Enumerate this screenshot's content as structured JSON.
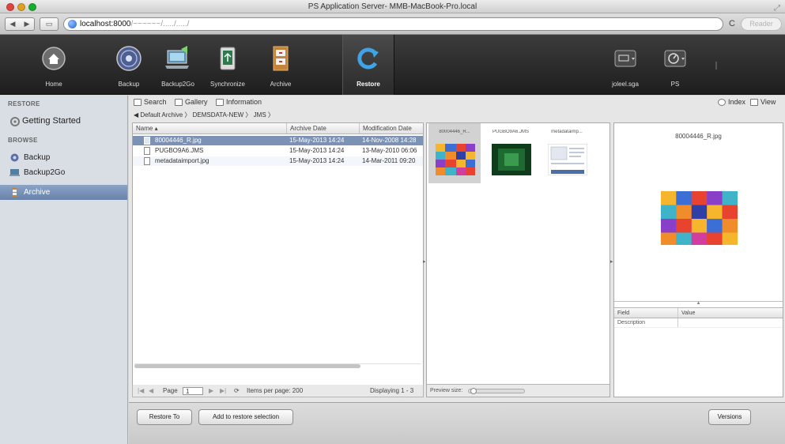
{
  "window": {
    "title": "PS Application Server- MMB-MacBook-Pro.local"
  },
  "browser": {
    "back": "◀",
    "forward": "▶",
    "address_host": "localhost:8000",
    "address_path": "/~~~~~~/...../...../",
    "reader_label": "Reader"
  },
  "toolbar": {
    "items": [
      {
        "label": "Home",
        "icon": "home-icon"
      },
      {
        "label": "Backup",
        "icon": "backup-icon"
      },
      {
        "label": "Backup2Go",
        "icon": "backup2go-icon"
      },
      {
        "label": "Synchronize",
        "icon": "synchronize-icon"
      },
      {
        "label": "Archive",
        "icon": "archive-icon"
      },
      {
        "label": "Restore",
        "icon": "restore-icon"
      }
    ],
    "active": "Restore",
    "user_label": "joleel.sga",
    "server_label": "PS"
  },
  "sidebar": {
    "restore_heading": "RESTORE",
    "browse_heading": "BROWSE",
    "items": [
      {
        "label": "Getting Started"
      },
      {
        "label": "Backup"
      },
      {
        "label": "Backup2Go"
      },
      {
        "label": "Archive"
      }
    ],
    "selected": "Archive"
  },
  "main": {
    "view_tabs": [
      {
        "label": "Search"
      },
      {
        "label": "Gallery"
      },
      {
        "label": "Information"
      }
    ],
    "right_tabs": [
      {
        "label": "Index"
      },
      {
        "label": "View"
      }
    ],
    "breadcrumb": "◀  Default Archive  〉 DEMSDATA-NEW  〉 JMS  〉",
    "list": {
      "columns": [
        "Name",
        "Archive Date",
        "Modification Date"
      ],
      "rows": [
        {
          "name": "80004446_R.jpg",
          "archive_date": "15-May-2013 14:24",
          "mod_date": "14-Nov-2008 14:28"
        },
        {
          "name": "PUGBO9A6.JMS",
          "archive_date": "15-May-2013 14:24",
          "mod_date": "13-May-2010 06:06"
        },
        {
          "name": "metadataimport.jpg",
          "archive_date": "15-May-2013 14:24",
          "mod_date": "14-Mar-2011 09:20"
        }
      ]
    },
    "pager": {
      "page_label": "Page",
      "page_value": "1",
      "items_per_page": "Items per page: 200",
      "displaying": "Displaying 1 - 3"
    },
    "thumbnails": [
      {
        "name": "80004446_R..."
      },
      {
        "name": "PUGBO9A6.JMS"
      },
      {
        "name": "metadataimp..."
      }
    ],
    "preview_size_label": "Preview size:",
    "preview": {
      "filename": "80004446_R.jpg",
      "field_header": "Field",
      "value_header": "Value",
      "fields": [
        {
          "field": "Description",
          "value": ""
        }
      ]
    }
  },
  "bottom": {
    "restore_to": "Restore To",
    "add_to_selection": "Add to restore selection",
    "versions": "Versions"
  },
  "colors": {
    "selection": "#7c92b4",
    "sidebar_selected": "#6782a9",
    "toolbar_dark": "#262626"
  }
}
